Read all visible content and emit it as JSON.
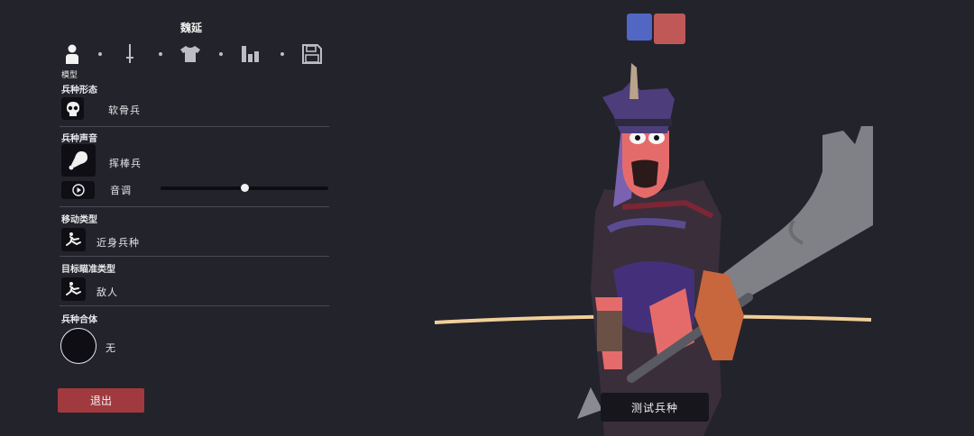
{
  "unit_name": "魏延",
  "tabs": [
    {
      "icon": "person-icon"
    },
    {
      "icon": "sword-icon"
    },
    {
      "icon": "shirt-icon"
    },
    {
      "icon": "stats-icon"
    },
    {
      "icon": "save-icon"
    }
  ],
  "active_tab_label": "模型",
  "sections": {
    "form": {
      "title": "兵种形态",
      "value": "软骨兵",
      "icon": "skull-icon"
    },
    "voice": {
      "title": "兵种声音",
      "value": "挥棒兵",
      "icon": "drumstick-icon",
      "pitch_label": "音调",
      "pitch_level": 0.5,
      "play_icon": "play-icon"
    },
    "movement": {
      "title": "移动类型",
      "value": "近身兵种",
      "icon": "running-figure-icon"
    },
    "targeting": {
      "title": "目标瞄准类型",
      "value": "敌人",
      "icon": "running-figure-icon"
    },
    "fusion": {
      "title": "兵种合体",
      "value": "无"
    }
  },
  "exit_label": "退出",
  "test_label": "测试兵种",
  "team_colors": {
    "blue": "#5266c4",
    "red": "#c05858"
  }
}
